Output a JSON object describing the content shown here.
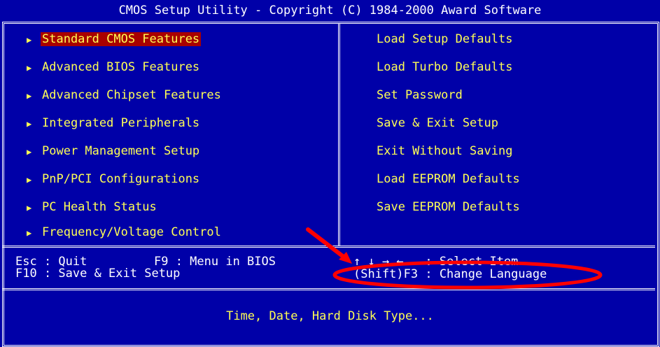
{
  "title": "CMOS Setup Utility - Copyright (C) 1984-2000 Award Software",
  "left_menu": [
    {
      "label": "Standard CMOS Features",
      "selected": true
    },
    {
      "label": "Advanced BIOS Features"
    },
    {
      "label": "Advanced Chipset Features"
    },
    {
      "label": "Integrated Peripherals"
    },
    {
      "label": "Power Management Setup"
    },
    {
      "label": "PnP/PCI Configurations"
    },
    {
      "label": "PC Health Status"
    },
    {
      "label": "Frequency/Voltage Control"
    }
  ],
  "right_menu": [
    {
      "label": "Load Setup Defaults"
    },
    {
      "label": "Load Turbo Defaults"
    },
    {
      "label": "Set Password"
    },
    {
      "label": "Save & Exit Setup"
    },
    {
      "label": "Exit Without Saving"
    },
    {
      "label": "Load EEPROM Defaults"
    },
    {
      "label": "Save EEPROM Defaults"
    }
  ],
  "submenu_marker": "▶",
  "help": {
    "esc": "Esc : Quit",
    "f9": "F9 : Menu in BIOS",
    "f10": "F10 : Save & Exit Setup",
    "select": "↑ ↓ → ←   : Select Item",
    "change_language": "(Shift)F3 : Change Language"
  },
  "description": "Time, Date, Hard Disk Type...",
  "colors": {
    "background": "#0000a8",
    "text": "#ffff55",
    "highlight": "#a80000",
    "annotation": "#ff0000"
  }
}
